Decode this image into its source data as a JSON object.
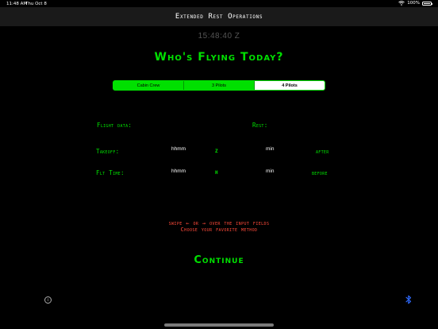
{
  "status_bar": {
    "time": "11:48 AM",
    "date": "Thu Oct 8",
    "battery": "100%",
    "battery_level": 1.0
  },
  "header": {
    "title": "Extended Rest Operations"
  },
  "clock": "15:48:40 Z",
  "headline": "Who's Flying Today?",
  "crew_selector": {
    "options": [
      "Cabin Crew",
      "3 Pilots",
      "4 Pilots"
    ],
    "selected": "4 Pilots"
  },
  "form": {
    "flight_data_label": "Flight data:",
    "rest_label": "Rest:",
    "takeoff_label": "Takeoff:",
    "takeoff_placeholder": "hhmm",
    "takeoff_unit": "Z",
    "takeoff_rest_placeholder": "min",
    "takeoff_rest_relation": "after",
    "flt_time_label": "Flt Time:",
    "flt_time_placeholder": "hhmm",
    "flt_time_unit": "H",
    "flt_time_rest_placeholder": "min",
    "flt_time_rest_relation": "before"
  },
  "hint": {
    "line1": "swipe ← or → over the input fields",
    "line2": "Choose your favorite method"
  },
  "continue_label": "Continue",
  "icons": {
    "info": "info-icon",
    "bluetooth": "bluetooth-icon"
  },
  "colors": {
    "accent_green": "#00e000",
    "hint_red": "#ff4a3a",
    "bluetooth_blue": "#2f6bff"
  }
}
